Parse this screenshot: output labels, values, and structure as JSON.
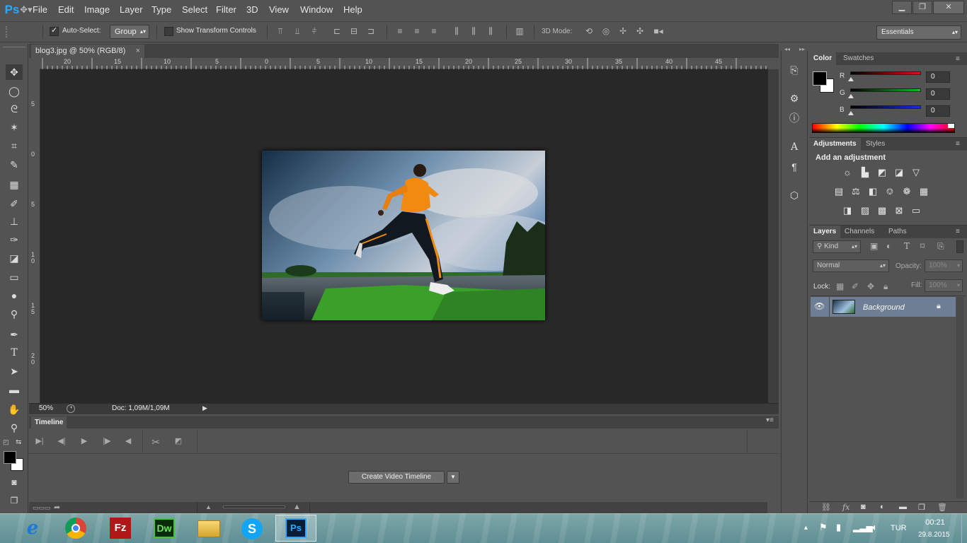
{
  "app": {
    "logo": "Ps"
  },
  "menu": [
    "File",
    "Edit",
    "Image",
    "Layer",
    "Type",
    "Select",
    "Filter",
    "3D",
    "View",
    "Window",
    "Help"
  ],
  "window_controls": {
    "minimize": "▁",
    "restore": "❐",
    "close": "✕"
  },
  "options_bar": {
    "auto_select_label": "Auto-Select:",
    "auto_select_value": "Group",
    "show_transform_label": "Show Transform Controls",
    "mode_3d_label": "3D Mode:",
    "workspace": "Essentials"
  },
  "document": {
    "tab_title": "blog3.jpg @ 50% (RGB/8)",
    "zoom": "50%",
    "doc_info": "Doc: 1,09M/1,09M"
  },
  "ruler": {
    "top": [
      "20",
      "15",
      "10",
      "5",
      "0",
      "5",
      "10",
      "15",
      "20",
      "25",
      "30",
      "35",
      "40",
      "45"
    ],
    "left": [
      "5",
      "0",
      "5",
      "1\n0",
      "1\n5",
      "2\n0"
    ]
  },
  "timeline": {
    "tab": "Timeline",
    "create_button": "Create Video Timeline"
  },
  "color_panel": {
    "tabs": [
      "Color",
      "Swatches"
    ],
    "channels": [
      {
        "label": "R",
        "value": "0",
        "color": "#c81010"
      },
      {
        "label": "G",
        "value": "0",
        "color": "#10a020"
      },
      {
        "label": "B",
        "value": "0",
        "color": "#1028c8"
      }
    ]
  },
  "adjustments_panel": {
    "tabs": [
      "Adjustments",
      "Styles"
    ],
    "heading": "Add an adjustment"
  },
  "layers_panel": {
    "tabs": [
      "Layers",
      "Channels",
      "Paths"
    ],
    "filter_kind": "Kind",
    "blend_mode": "Normal",
    "opacity_label": "Opacity:",
    "opacity_value": "100%",
    "lock_label": "Lock:",
    "fill_label": "Fill:",
    "fill_value": "100%",
    "layers": [
      {
        "name": "Background",
        "visible": true,
        "locked": true
      }
    ]
  },
  "taskbar": {
    "apps": [
      "e",
      "Chrome",
      "Fz",
      "Dw",
      "Files",
      "S",
      "Ps"
    ],
    "language": "TUR",
    "time": "00:21",
    "date": "29.8.2015"
  }
}
